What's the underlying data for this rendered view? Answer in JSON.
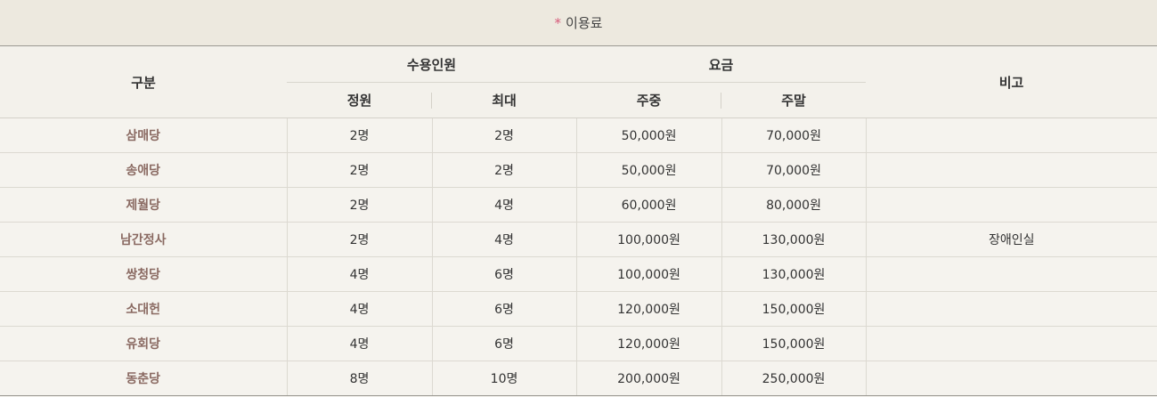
{
  "caption": {
    "marker": "*",
    "title": "이용료"
  },
  "table": {
    "headers": {
      "category": "구분",
      "capacity_group": "수용인원",
      "fee_group": "요금",
      "note": "비고",
      "standard": "정원",
      "maximum": "최대",
      "weekday": "주중",
      "weekend": "주말"
    },
    "rows": [
      {
        "name": "삼매당",
        "standard": "2명",
        "maximum": "2명",
        "weekday": "50,000원",
        "weekend": "70,000원",
        "note": ""
      },
      {
        "name": "송애당",
        "standard": "2명",
        "maximum": "2명",
        "weekday": "50,000원",
        "weekend": "70,000원",
        "note": ""
      },
      {
        "name": "제월당",
        "standard": "2명",
        "maximum": "4명",
        "weekday": "60,000원",
        "weekend": "80,000원",
        "note": ""
      },
      {
        "name": "남간정사",
        "standard": "2명",
        "maximum": "4명",
        "weekday": "100,000원",
        "weekend": "130,000원",
        "note": "장애인실"
      },
      {
        "name": "쌍청당",
        "standard": "4명",
        "maximum": "6명",
        "weekday": "100,000원",
        "weekend": "130,000원",
        "note": ""
      },
      {
        "name": "소대헌",
        "standard": "4명",
        "maximum": "6명",
        "weekday": "120,000원",
        "weekend": "150,000원",
        "note": ""
      },
      {
        "name": "유회당",
        "standard": "4명",
        "maximum": "6명",
        "weekday": "120,000원",
        "weekend": "150,000원",
        "note": ""
      },
      {
        "name": "동춘당",
        "standard": "8명",
        "maximum": "10명",
        "weekday": "200,000원",
        "weekend": "250,000원",
        "note": ""
      }
    ]
  },
  "colors": {
    "caption_bg": "#ede9df",
    "table_bg": "#f5f3ee",
    "marker": "#d65a7a",
    "room_name": "#8a6a62",
    "border": "#dcd9d1"
  }
}
